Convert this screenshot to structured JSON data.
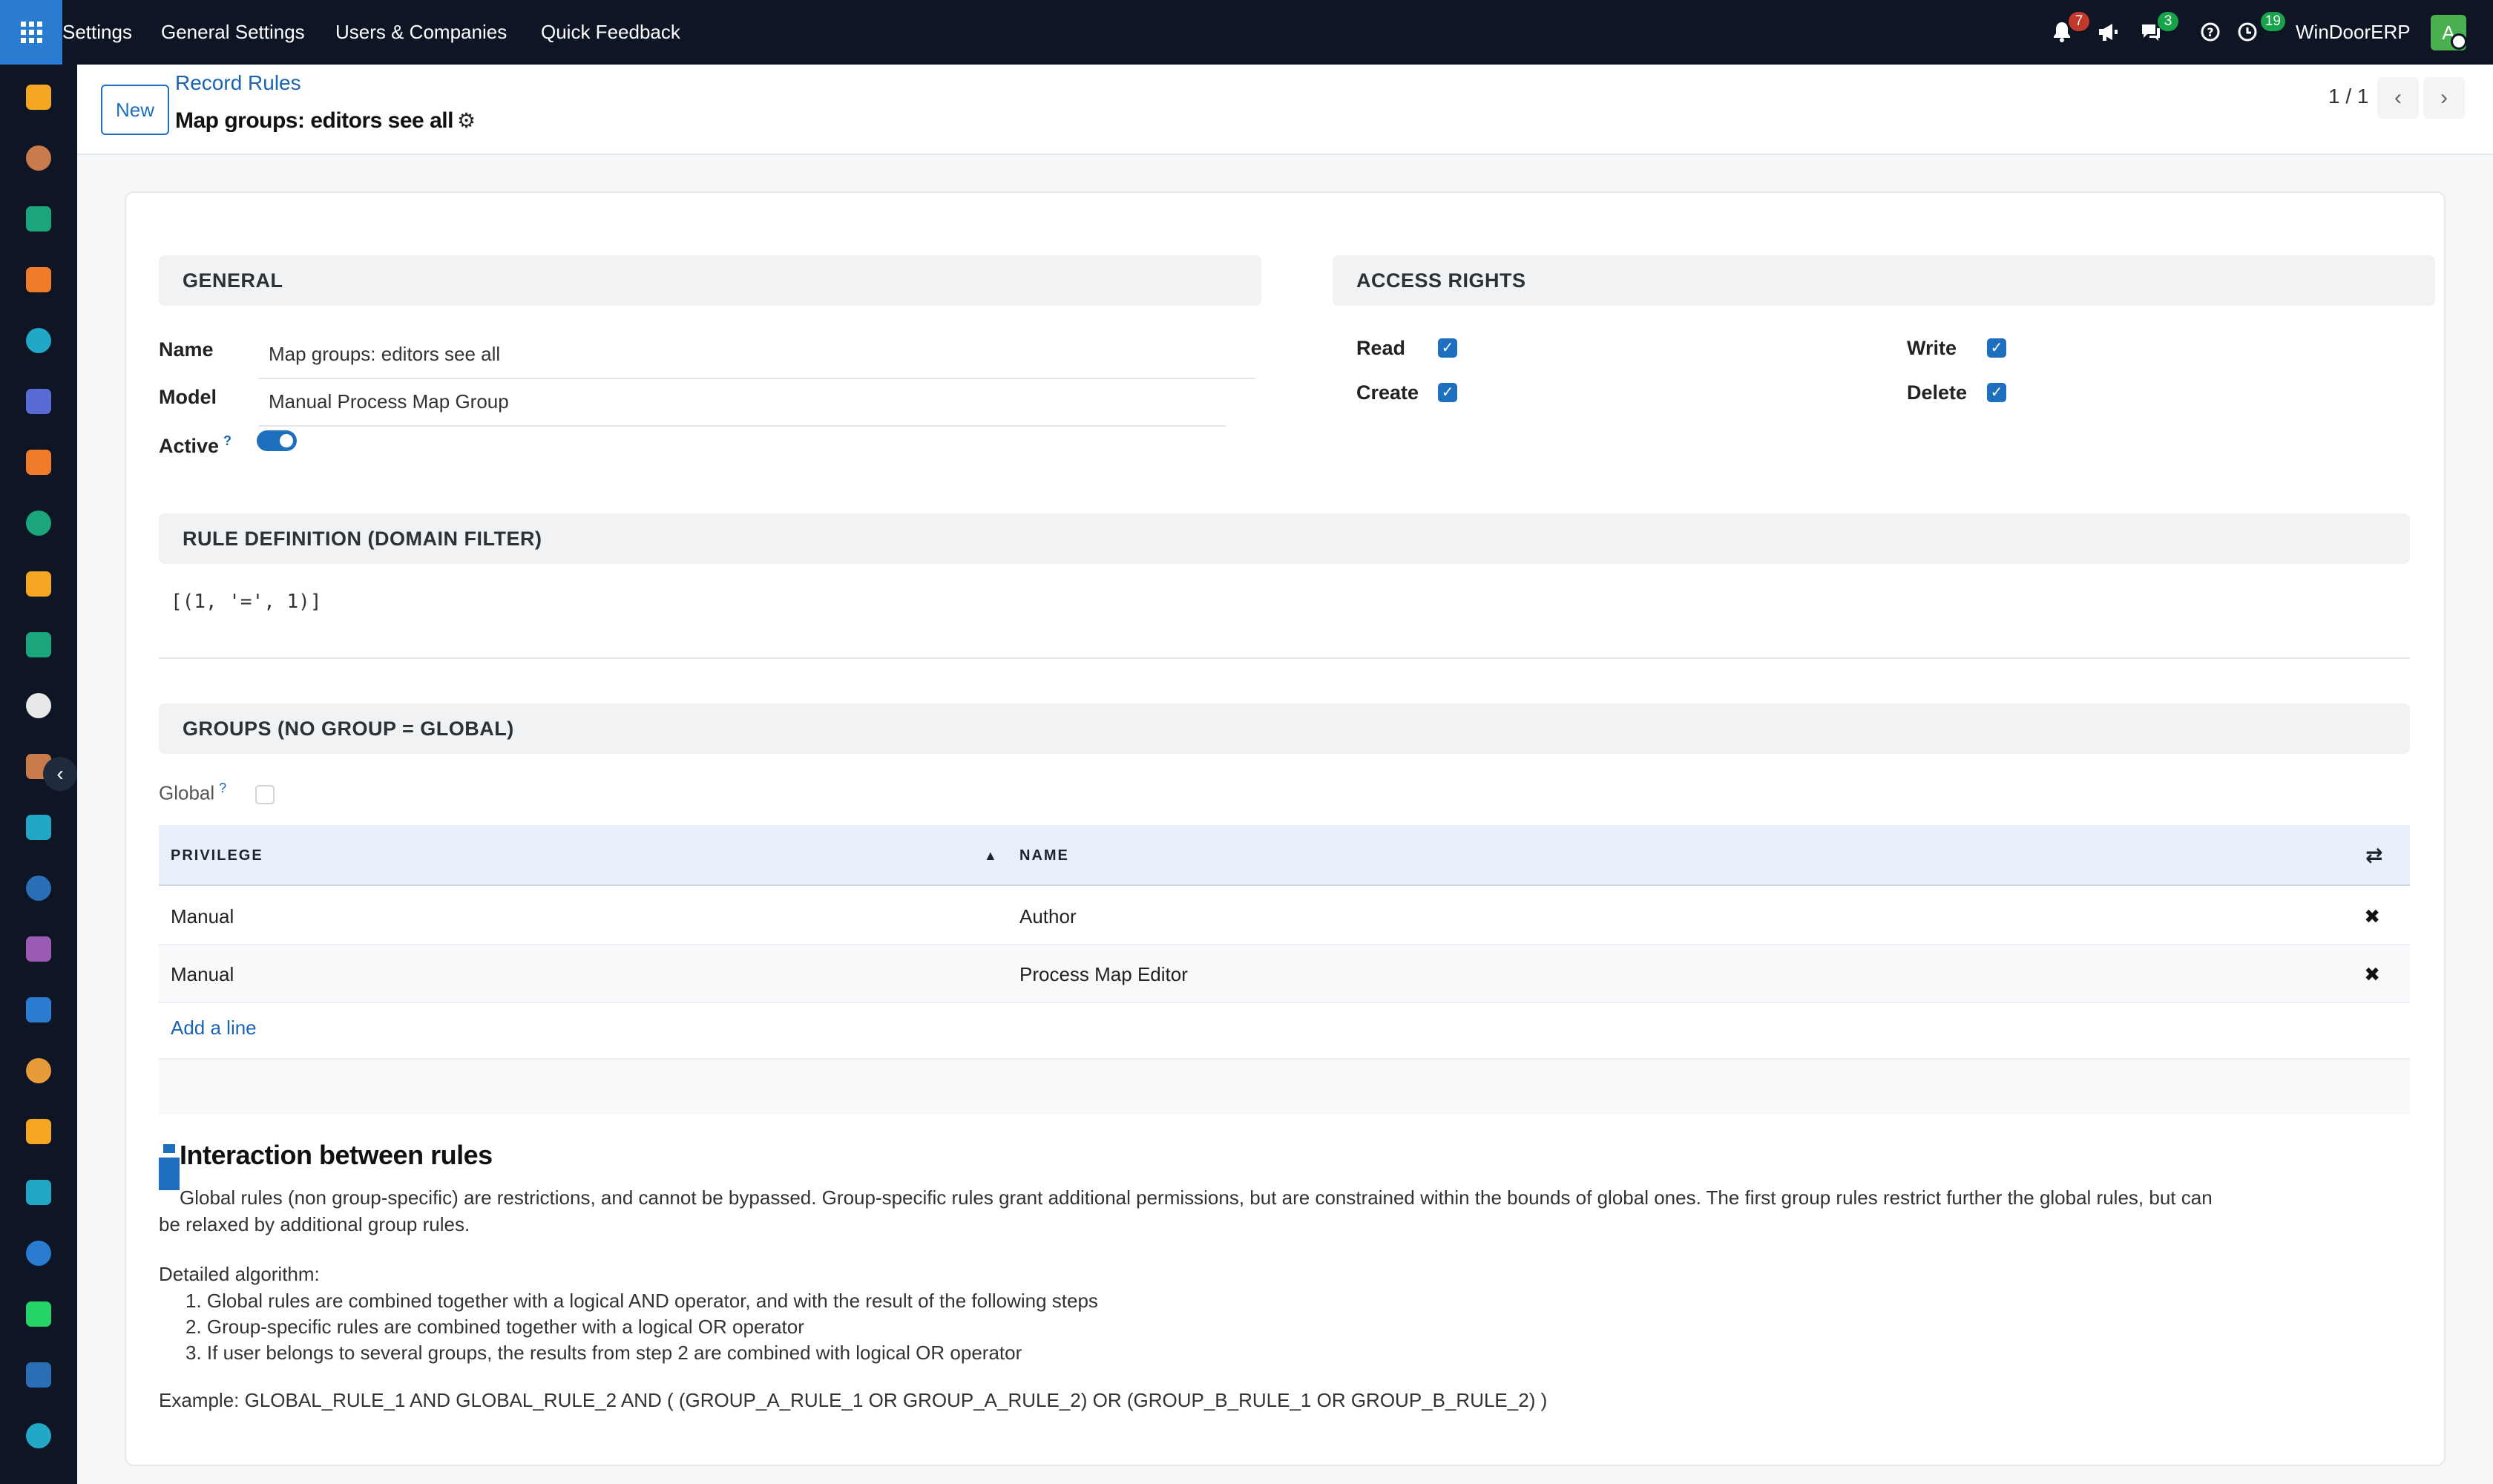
{
  "nav": {
    "apps_icon": "grid-icon",
    "menu": [
      "Settings",
      "General Settings",
      "Users & Companies",
      "Quick Feedback"
    ],
    "notifications_count": "7",
    "messages_count": "3",
    "activities_count": "19",
    "company": "WinDoorERP",
    "user_initial": "A"
  },
  "control_panel": {
    "new_label": "New",
    "breadcrumb": "Record Rules",
    "title": "Map groups: editors see all",
    "pager": "1 / 1"
  },
  "general": {
    "heading": "GENERAL",
    "name_label": "Name",
    "name_value": "Map groups: editors see all",
    "model_label": "Model",
    "model_value": "Manual Process Map Group",
    "active_label": "Active",
    "help_mark": "?",
    "active": true
  },
  "access_rights": {
    "heading": "ACCESS RIGHTS",
    "read_label": "Read",
    "write_label": "Write",
    "create_label": "Create",
    "delete_label": "Delete",
    "read": true,
    "write": true,
    "create": true,
    "delete": true
  },
  "rule_definition": {
    "heading": "RULE DEFINITION (DOMAIN FILTER)",
    "domain": "[(1, '=', 1)]"
  },
  "groups": {
    "heading": "GROUPS (NO GROUP = GLOBAL)",
    "global_label": "Global",
    "help_mark": "?",
    "global": false,
    "columns": [
      "PRIVILEGE",
      "NAME"
    ],
    "rows": [
      {
        "privilege": "Manual",
        "name": "Author"
      },
      {
        "privilege": "Manual",
        "name": "Process Map Editor"
      }
    ],
    "add_line": "Add a line"
  },
  "help": {
    "title": "Interaction between rules",
    "paragraph_line1": "Global rules (non group-specific) are restrictions, and cannot be bypassed. Group-specific rules grant additional permissions, but are constrained within the bounds of global ones. The first group rules restrict further the global rules, but can",
    "paragraph_line2": "be relaxed by additional group rules.",
    "algorithm_title": "Detailed algorithm:",
    "steps": [
      "Global rules are combined together with a logical AND operator, and with the result of the following steps",
      "Group-specific rules are combined together with a logical OR operator",
      "If user belongs to several groups, the results from step 2 are combined with logical OR operator"
    ],
    "example": "Example: GLOBAL_RULE_1 AND GLOBAL_RULE_2 AND ( (GROUP_A_RULE_1 OR GROUP_A_RULE_2) OR (GROUP_B_RULE_1 OR GROUP_B_RULE_2) )"
  },
  "sidebar_icons": [
    {
      "name": "dashboard-app-icon",
      "color": "#f5a623"
    },
    {
      "name": "inventory-app-icon",
      "color": "#c97b4b"
    },
    {
      "name": "contacts-app-icon",
      "color": "#1aa67a"
    },
    {
      "name": "discuss-app-icon",
      "color": "#f07b2a"
    },
    {
      "name": "website-app-icon",
      "color": "#22a7c7"
    },
    {
      "name": "email-marketing-app-icon",
      "color": "#5b6bd6"
    },
    {
      "name": "livechat-app-icon",
      "color": "#f07b2a"
    },
    {
      "name": "project-app-icon",
      "color": "#1aa67a"
    },
    {
      "name": "reporting-app-icon",
      "color": "#f5a623"
    },
    {
      "name": "employees-app-icon",
      "color": "#1aa67a"
    },
    {
      "name": "apps-cube-icon",
      "color": "#e8e8e8"
    },
    {
      "name": "sales-app-icon",
      "color": "#c97b4b"
    },
    {
      "name": "todo-app-icon",
      "color": "#22a7c7"
    },
    {
      "name": "knowledge-app-icon",
      "color": "#2a6fb5"
    },
    {
      "name": "studio-app-icon",
      "color": "#9b5bb5"
    },
    {
      "name": "invoicing-app-icon",
      "color": "#2a7bd2"
    },
    {
      "name": "team-app-icon",
      "color": "#e89b3a"
    },
    {
      "name": "calendar-app-icon",
      "color": "#f5a623"
    },
    {
      "name": "sign-app-icon",
      "color": "#22a7c7"
    },
    {
      "name": "dashboards-app-icon",
      "color": "#2a7bd2"
    },
    {
      "name": "whatsapp-app-icon",
      "color": "#25d366"
    },
    {
      "name": "time-off-app-icon",
      "color": "#2a6fb5"
    },
    {
      "name": "website-alt-app-icon",
      "color": "#22a7c7"
    }
  ]
}
